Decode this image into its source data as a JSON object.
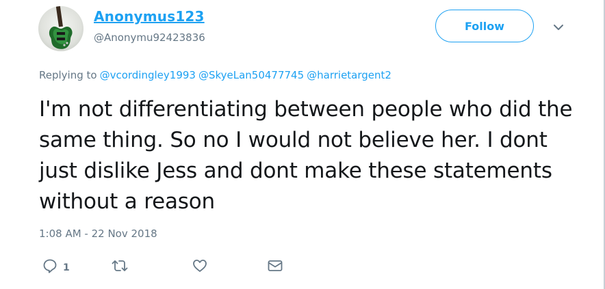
{
  "user": {
    "display_name": "Anonymus123",
    "handle": "@Anonymu92423836",
    "avatar": "guitar-avatar"
  },
  "header": {
    "follow_label": "Follow",
    "caret_icon": "chevron-down-icon"
  },
  "reply_context": {
    "prefix": "Replying to",
    "mentions": [
      "@vcordingley1993",
      "@SkyeLan50477745",
      "@harrietargent2"
    ]
  },
  "tweet": {
    "text": "I'm not differentiating between people who did the same thing. So no I would not believe her. I dont just dislike Jess and dont make these statements without a reason",
    "timestamp": "1:08 AM - 22 Nov 2018"
  },
  "actions": {
    "reply_icon": "reply-icon",
    "reply_count": "1",
    "retweet_icon": "retweet-icon",
    "like_icon": "heart-icon",
    "dm_icon": "envelope-icon"
  },
  "colors": {
    "accent": "#1da1f2",
    "secondary_text": "#657786",
    "primary_text": "#14171a",
    "icon": "#657786"
  }
}
